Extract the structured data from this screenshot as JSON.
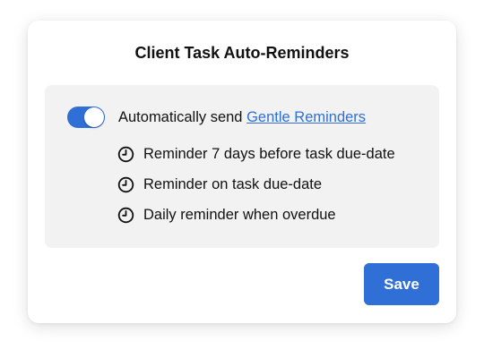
{
  "dialog": {
    "title": "Client Task Auto-Reminders"
  },
  "settings": {
    "toggle_enabled": true,
    "auto_send_prefix": "Automatically send ",
    "auto_send_link": "Gentle Reminders",
    "reminders": [
      {
        "icon": "clock-icon",
        "label": "Reminder 7 days before task due-date"
      },
      {
        "icon": "clock-icon",
        "label": "Reminder on task due-date"
      },
      {
        "icon": "clock-icon",
        "label": "Daily reminder when overdue"
      }
    ]
  },
  "actions": {
    "save_label": "Save"
  },
  "colors": {
    "accent": "#2f6fd6",
    "panel_bg": "#f2f2f2"
  }
}
